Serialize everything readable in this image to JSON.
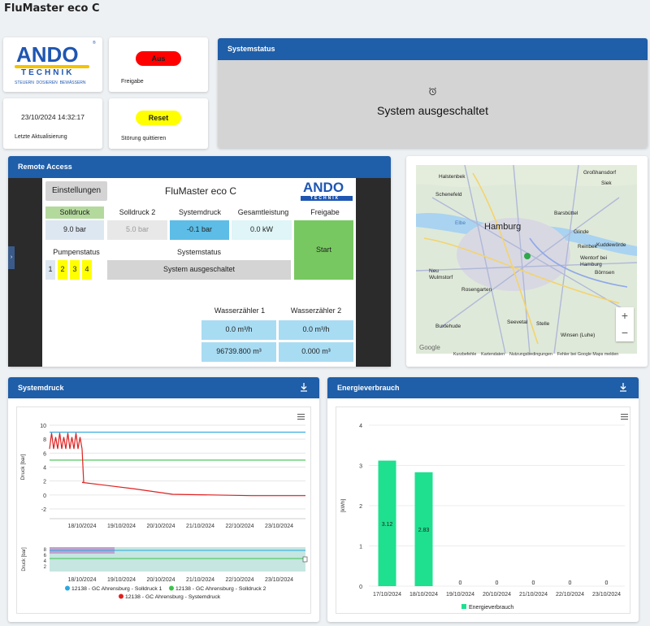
{
  "page": {
    "title": "FluMaster eco C"
  },
  "tiles": {
    "freigabe": {
      "pill": "Aus",
      "label": "Freigabe",
      "color": "#ff0000"
    },
    "timestamp": {
      "value": "23/10/2024 14:32:17",
      "label": "Letzte Aktualisierung"
    },
    "reset": {
      "pill": "Reset",
      "label": "Störung quittieren",
      "color": "#ffff00"
    }
  },
  "logo": {
    "main": "ANDO",
    "sub": "TECHNIK",
    "tagline": "STEUERN  DOSIEREN  BEWÄSSERN"
  },
  "systemstatus": {
    "title": "Systemstatus",
    "icon": "alarm-clock-icon",
    "text": "System ausgeschaltet"
  },
  "remote": {
    "title": "Remote Access",
    "settings_button": "Einstellungen",
    "device_title": "FluMaster eco C",
    "logo_main": "ANDO",
    "logo_sub": "TECHNIK",
    "headers": {
      "solldruck": "Solldruck",
      "solldruck2": "Solldruck 2",
      "systemdruck": "Systemdruck",
      "gesamtleistung": "Gesamtleistung",
      "freigabe": "Freigabe"
    },
    "values": {
      "solldruck": "9.0 bar",
      "solldruck2": "5.0 bar",
      "systemdruck": "-0.1 bar",
      "gesamtleistung": "0.0 kW"
    },
    "start_button": "Start",
    "pumpenstatus_label": "Pumpenstatus",
    "pumps": [
      "1",
      "2",
      "3",
      "4"
    ],
    "systemstatus_label": "Systemstatus",
    "systemstatus_value": "System ausgeschaltet",
    "wz1_label": "Wasserzähler 1",
    "wz2_label": "Wasserzähler 2",
    "wz1_flow": "0.0 m³/h",
    "wz2_flow": "0.0 m³/h",
    "wz1_total": "96739.800 m³",
    "wz2_total": "0.000 m³"
  },
  "map": {
    "places": [
      "Halstenbek",
      "Schenefeld",
      "Hamburg",
      "Barsbüttel",
      "Glinde",
      "Reinbek",
      "Wentorf bei Hamburg",
      "Börnsen",
      "Neu Wulmstorf",
      "Rosengarten",
      "Seevetal",
      "Stelle",
      "Winsen (Luhe)",
      "Buxtehude",
      "Großhansdorf",
      "Siek",
      "Kuddewörde",
      "Elbe"
    ],
    "attribution": [
      "Kurzbefehle",
      "Kartendaten",
      "Nutzungsbedingungen",
      "Fehler bei Google Maps melden"
    ],
    "zoom_in": "+",
    "zoom_out": "−",
    "brand": "Google"
  },
  "systemdruck_panel": {
    "title": "Systemdruck"
  },
  "energie_panel": {
    "title": "Energieverbrauch"
  },
  "chart_data": [
    {
      "type": "line",
      "ylabel": "Druck [bar]",
      "ylim": [
        -2,
        10
      ],
      "yticks": [
        10,
        8,
        6,
        4,
        2,
        0,
        -2
      ],
      "xticks": [
        "18/10/2024",
        "19/10/2024",
        "20/10/2024",
        "21/10/2024",
        "22/10/2024",
        "23/10/2024"
      ],
      "series": [
        {
          "name": "12138 - GC Ahrensburg - Solldruck 1",
          "color": "#29a8e0",
          "values": [
            9.0,
            9.0,
            9.0,
            9.0,
            9.0,
            9.0
          ]
        },
        {
          "name": "12138 - GC Ahrensburg - Solldruck 2",
          "color": "#3ec24c",
          "values": [
            5.0,
            5.0,
            5.0,
            5.0,
            5.0,
            5.0
          ]
        },
        {
          "name": "12138 - GC Ahrensburg - Systemdruck",
          "color": "#e02020",
          "values": [
            8.5,
            1.8,
            0.9,
            0.1,
            0.0,
            -0.1
          ]
        }
      ],
      "navigator": {
        "ylabel": "Druck [bar]",
        "yticks": [
          8,
          6,
          4,
          2
        ],
        "xticks": [
          "18/10/2024",
          "19/10/2024",
          "20/10/2024",
          "21/10/2024",
          "22/10/2024",
          "23/10/2024"
        ]
      }
    },
    {
      "type": "bar",
      "ylabel": "[kWh]",
      "ylim": [
        0,
        4
      ],
      "yticks": [
        4,
        3,
        2,
        1,
        0
      ],
      "categories": [
        "17/10/2024",
        "18/10/2024",
        "19/10/2024",
        "20/10/2024",
        "21/10/2024",
        "22/10/2024",
        "23/10/2024"
      ],
      "series": [
        {
          "name": "Energieverbrauch",
          "color": "#1ee08f",
          "values": [
            3.12,
            2.83,
            0,
            0,
            0,
            0,
            0
          ]
        }
      ]
    }
  ]
}
